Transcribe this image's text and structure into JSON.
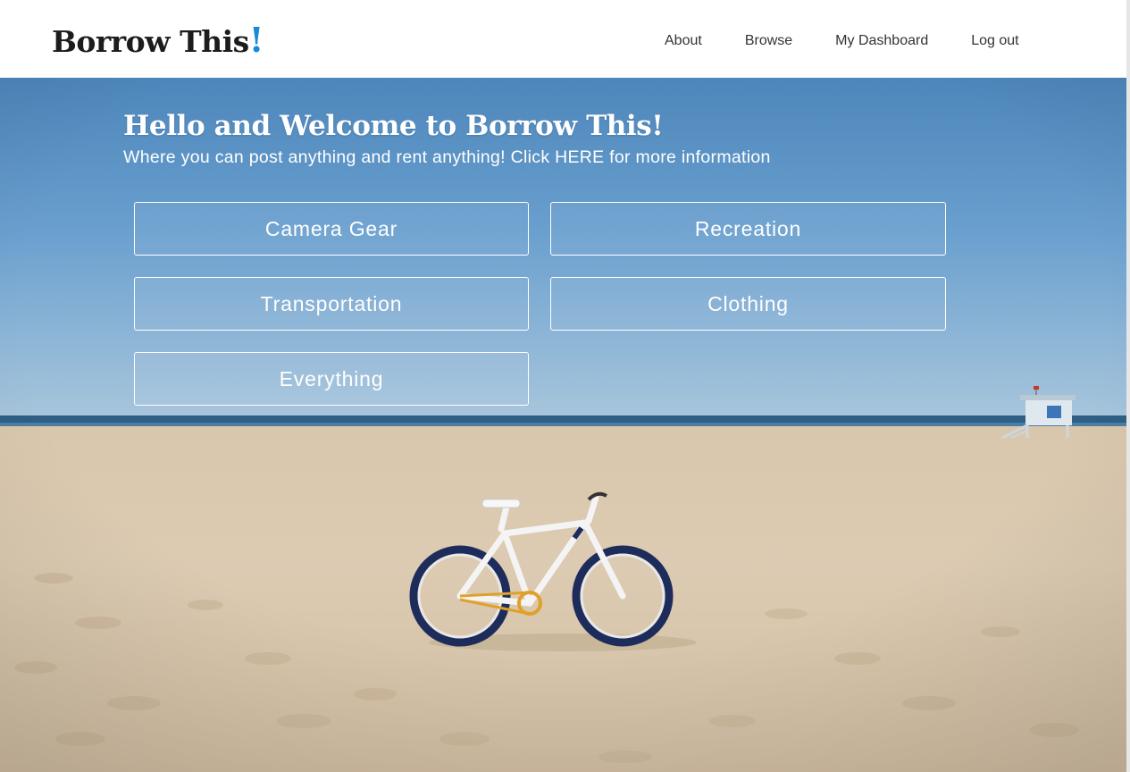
{
  "brand": {
    "name": "Borrow This",
    "exclamation": "!",
    "accent_color": "#1a8ad8"
  },
  "nav": {
    "items": [
      {
        "label": "About"
      },
      {
        "label": "Browse"
      },
      {
        "label": "My Dashboard"
      },
      {
        "label": "Log out"
      }
    ]
  },
  "hero": {
    "title": "Hello and Welcome to Borrow This!",
    "subtitle": "Where you can post anything and rent anything! Click HERE for more information",
    "background": "beach-with-bicycle-photo",
    "categories": [
      {
        "label": "Camera Gear"
      },
      {
        "label": "Recreation"
      },
      {
        "label": "Transportation"
      },
      {
        "label": "Clothing"
      },
      {
        "label": "Everything"
      }
    ]
  }
}
